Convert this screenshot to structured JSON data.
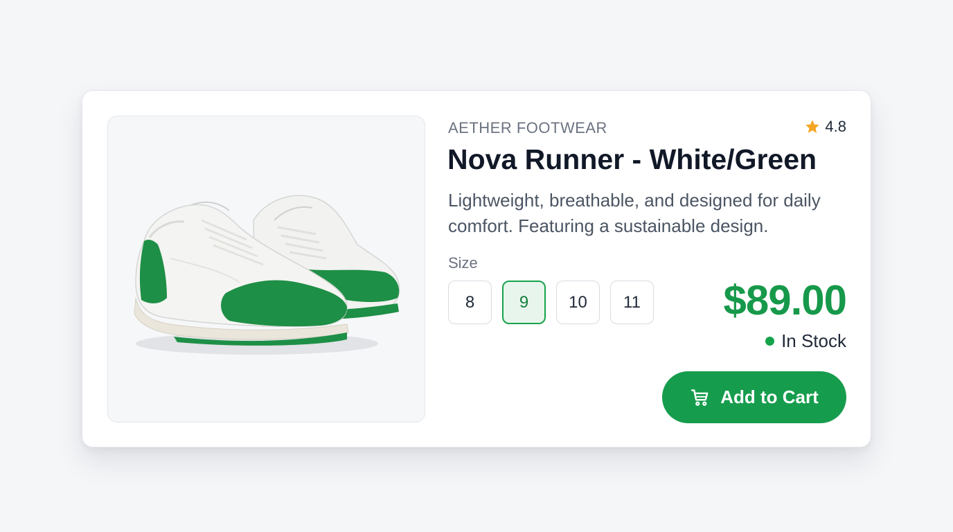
{
  "product": {
    "brand": "AETHER FOOTWEAR",
    "rating": "4.8",
    "title": "Nova Runner - White/Green",
    "description": "Lightweight, breathable, and designed for daily comfort. Featuring a sustainable design.",
    "image_alt": "White and green sneakers",
    "size_label": "Size",
    "sizes": [
      "8",
      "9",
      "10",
      "11"
    ],
    "selected_size": "9",
    "price": "$89.00",
    "stock_status": "In Stock",
    "add_to_cart_label": "Add to Cart"
  },
  "icons": {
    "rating": "star-icon",
    "stock": "status-dot",
    "cart": "shopping-cart-icon"
  },
  "colors": {
    "accent": "#169c4d",
    "price": "#16994a",
    "star": "#f5a623",
    "title": "#111827",
    "muted": "#6b7280"
  }
}
